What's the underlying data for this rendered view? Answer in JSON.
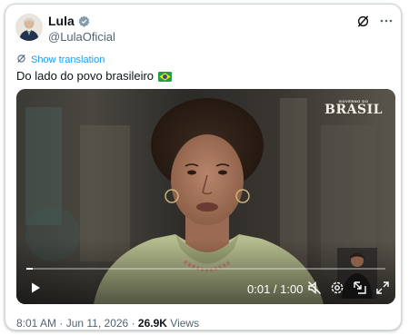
{
  "author": {
    "name": "Lula",
    "handle": "@LulaOficial",
    "verified_icon": "verified-badge-icon"
  },
  "actions": {
    "grok_icon": "grok-icon",
    "more_icon": "more-icon"
  },
  "translation": {
    "label": "Show translation"
  },
  "tweet": {
    "text": "Do lado do povo brasileiro",
    "emoji": "brazil-flag-icon"
  },
  "video": {
    "brand_small": "GOVERNO DO",
    "brand_big": "BRASIL",
    "time": "0:01 / 1:00",
    "progress": 0.017,
    "controls": [
      "play-icon",
      "mute-icon",
      "settings-icon",
      "pip-icon",
      "fullscreen-icon"
    ]
  },
  "meta": {
    "time": "8:01 AM",
    "separator": "·",
    "date": "Jun 11, 2026",
    "views_count": "26.9K",
    "views_label": "Views"
  },
  "colors": {
    "accent": "#1d9bf0",
    "text": "#0f1419",
    "secondary": "#536471",
    "border": "#cfd9de"
  }
}
